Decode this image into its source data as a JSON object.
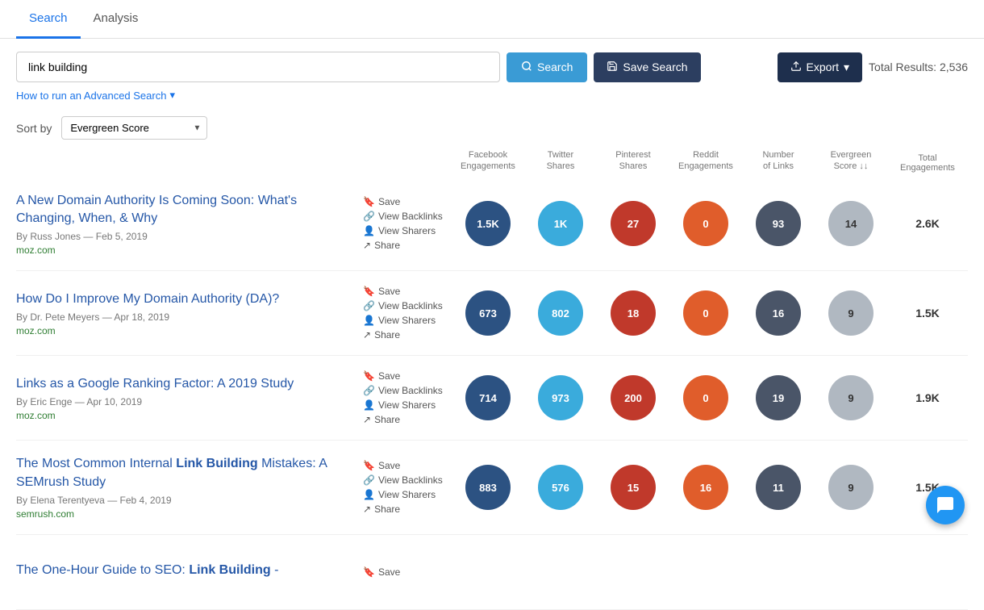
{
  "tabs": [
    {
      "label": "Search",
      "active": true
    },
    {
      "label": "Analysis",
      "active": false
    }
  ],
  "search": {
    "input_value": "link building",
    "input_placeholder": "link building",
    "search_button": "Search",
    "save_button": "Save Search",
    "export_button": "Export",
    "advanced_link": "How to run an Advanced Search",
    "total_results": "Total Results: 2,536"
  },
  "sort": {
    "label": "Sort by",
    "value": "Evergreen Score"
  },
  "columns": [
    {
      "id": "facebook",
      "label": "Facebook\nEngagements"
    },
    {
      "id": "twitter",
      "label": "Twitter\nShares"
    },
    {
      "id": "pinterest",
      "label": "Pinterest\nShares"
    },
    {
      "id": "reddit",
      "label": "Reddit\nEngagements"
    },
    {
      "id": "links",
      "label": "Number\nof Links"
    },
    {
      "id": "evergreen",
      "label": "Evergreen\nScore ↓"
    },
    {
      "id": "total",
      "label": "Total\nEngagements"
    }
  ],
  "results": [
    {
      "title": "A New Domain Authority Is Coming Soon: What's Changing, When, & Why",
      "author": "By Russ Jones",
      "date": "Feb 5, 2019",
      "domain": "moz.com",
      "facebook": "1.5K",
      "twitter": "1K",
      "pinterest": "27",
      "reddit": "0",
      "links": "93",
      "evergreen": "14",
      "total": "2.6K",
      "highlight_words": ""
    },
    {
      "title": "How Do I Improve My Domain Authority (DA)?",
      "author": "By Dr. Pete Meyers",
      "date": "Apr 18, 2019",
      "domain": "moz.com",
      "facebook": "673",
      "twitter": "802",
      "pinterest": "18",
      "reddit": "0",
      "links": "16",
      "evergreen": "9",
      "total": "1.5K",
      "highlight_words": ""
    },
    {
      "title": "Links as a Google Ranking Factor: A 2019 Study",
      "author": "By Eric Enge",
      "date": "Apr 10, 2019",
      "domain": "moz.com",
      "facebook": "714",
      "twitter": "973",
      "pinterest": "200",
      "reddit": "0",
      "links": "19",
      "evergreen": "9",
      "total": "1.9K",
      "highlight_words": ""
    },
    {
      "title": "The Most Common Internal __Link Building__ Mistakes: A SEMrush Study",
      "author": "By Elena Terentyeva",
      "date": "Feb 4, 2019",
      "domain": "semrush.com",
      "facebook": "883",
      "twitter": "576",
      "pinterest": "15",
      "reddit": "16",
      "links": "11",
      "evergreen": "9",
      "total": "1.5K",
      "highlight_words": "Link Building"
    },
    {
      "title": "The One-Hour Guide to SEO: __Link Building__ -",
      "author": "",
      "date": "",
      "domain": "",
      "facebook": "",
      "twitter": "",
      "pinterest": "",
      "reddit": "",
      "links": "",
      "evergreen": "",
      "total": "",
      "highlight_words": "Link Building",
      "partial": true
    }
  ],
  "actions": [
    "Save",
    "View Backlinks",
    "View Sharers",
    "Share"
  ],
  "icons": {
    "search": "🔍",
    "save": "💾",
    "export": "⬆",
    "advanced_arrow": "▾",
    "bookmark": "🔖",
    "chain": "🔗",
    "person": "👤",
    "share": "↗"
  }
}
